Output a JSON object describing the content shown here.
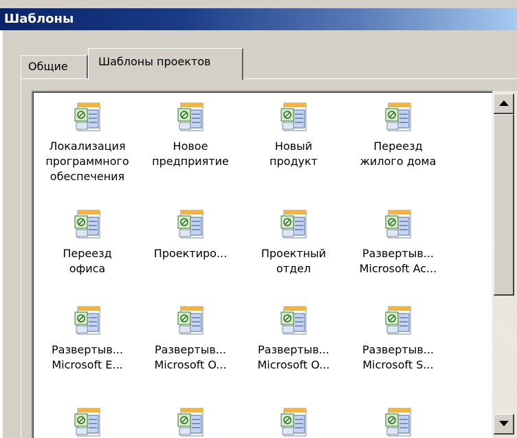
{
  "window": {
    "title": "Шаблоны"
  },
  "tabs": [
    {
      "label": "Общие",
      "selected": false
    },
    {
      "label": "Шаблоны проектов",
      "selected": true
    }
  ],
  "templates": [
    {
      "label": "Локализация\nпрограммного\nобеспечения",
      "icon": "project-template-icon"
    },
    {
      "label": "Новое\nпредприятие",
      "icon": "project-template-icon"
    },
    {
      "label": "Новый\nпродукт",
      "icon": "project-template-icon"
    },
    {
      "label": "Переезд\nжилого дома",
      "icon": "project-template-icon"
    },
    {
      "label": "Переезд\nофиса",
      "icon": "project-template-icon"
    },
    {
      "label": "Проектиро...",
      "icon": "project-template-icon"
    },
    {
      "label": "Проектный\nотдел",
      "icon": "project-template-icon"
    },
    {
      "label": "Развертыв...\nMicrosoft Ac...",
      "icon": "project-template-icon"
    },
    {
      "label": "Развертыв...\nMicrosoft E...",
      "icon": "project-template-icon"
    },
    {
      "label": "Развертыв...\nMicrosoft O...",
      "icon": "project-template-icon"
    },
    {
      "label": "Развертыв...\nMicrosoft O...",
      "icon": "project-template-icon"
    },
    {
      "label": "Развертыв...\nMicrosoft S...",
      "icon": "project-template-icon"
    },
    {
      "label": "",
      "icon": "project-template-icon"
    },
    {
      "label": "",
      "icon": "project-template-icon"
    },
    {
      "label": "",
      "icon": "project-template-icon"
    },
    {
      "label": "",
      "icon": "project-template-icon"
    }
  ],
  "colors": {
    "titlebar_start": "#0a246a",
    "titlebar_end": "#a6caf0",
    "window_face": "#d4d0c8",
    "list_background": "#ffffff"
  }
}
